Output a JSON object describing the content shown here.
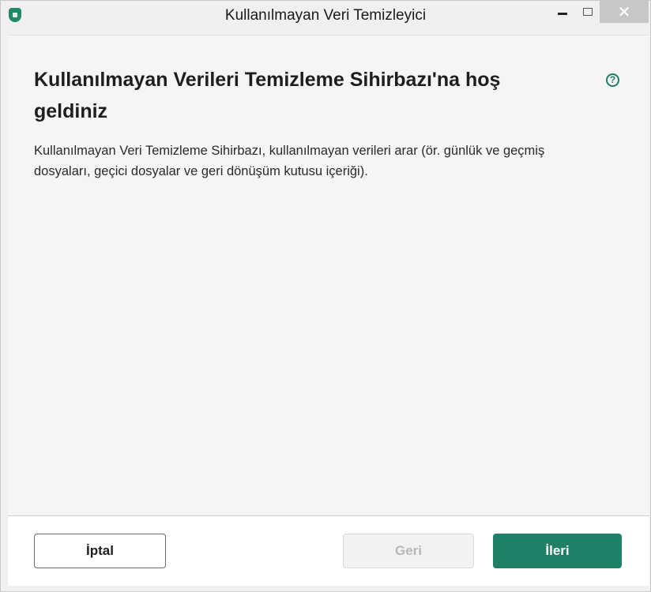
{
  "window": {
    "title": "Kullanılmayan Veri Temizleyici",
    "icon": "kaspersky-app-icon",
    "controls": {
      "minimize": "minimize-icon",
      "maximize": "maximize-icon",
      "close_glyph": "✕"
    }
  },
  "main": {
    "title": "Kullanılmayan Verileri Temizleme Sihirbazı'na hoş geldiniz",
    "help_glyph": "?",
    "description": "Kullanılmayan Veri Temizleme Sihirbazı, kullanılmayan verileri arar (ör. günlük ve geçmiş dosyaları, geçici dosyalar ve geri dönüşüm kutusu içeriği)."
  },
  "footer": {
    "cancel_label": "İptal",
    "back_label": "Geri",
    "next_label": "İleri"
  },
  "colors": {
    "accent": "#1f7f67",
    "disabled_text": "#b8b8b8"
  }
}
